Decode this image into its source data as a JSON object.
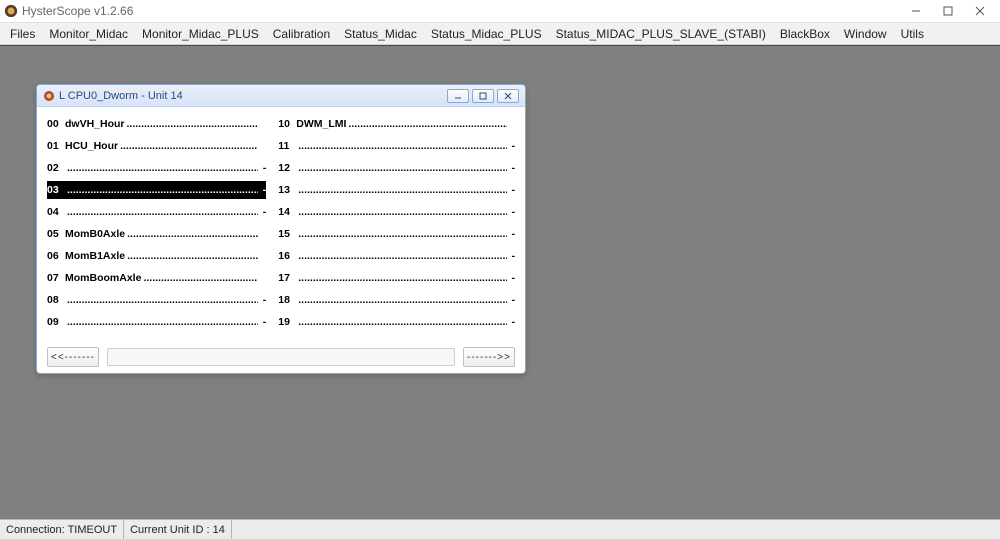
{
  "app": {
    "title": "HysterScope v1.2.66",
    "icon_name": "app-icon",
    "accent": "#3573b8"
  },
  "window_controls": {
    "minimize": "–",
    "maximize": "☐",
    "close": "✕"
  },
  "menubar": [
    "Files",
    "Monitor_Midac",
    "Monitor_Midac_PLUS",
    "Calibration",
    "Status_Midac",
    "Status_Midac_PLUS",
    "Status_MIDAC_PLUS_SLAVE_(STABI)",
    "BlackBox",
    "Window",
    "Utils"
  ],
  "child_window": {
    "title": "L CPU0_Dworm - Unit 14",
    "buttons": {
      "min": "–",
      "max": "☐",
      "close": "✕"
    },
    "nav": {
      "prev": "<<-------",
      "next": "------->>"
    },
    "selected_index_left": 3,
    "left": [
      {
        "num": "00",
        "label": "dwVH_Hour",
        "val": ""
      },
      {
        "num": "01",
        "label": "HCU_Hour",
        "val": ""
      },
      {
        "num": "02",
        "label": "",
        "val": "-"
      },
      {
        "num": "03",
        "label": "",
        "val": "-"
      },
      {
        "num": "04",
        "label": "",
        "val": "-"
      },
      {
        "num": "05",
        "label": "MomB0Axle",
        "val": ""
      },
      {
        "num": "06",
        "label": "MomB1Axle",
        "val": ""
      },
      {
        "num": "07",
        "label": "MomBoomAxle",
        "val": ""
      },
      {
        "num": "08",
        "label": "",
        "val": "-"
      },
      {
        "num": "09",
        "label": "",
        "val": "-"
      }
    ],
    "right": [
      {
        "num": "10",
        "label": "DWM_LMI",
        "val": ""
      },
      {
        "num": "11",
        "label": "",
        "val": "-"
      },
      {
        "num": "12",
        "label": "",
        "val": "-"
      },
      {
        "num": "13",
        "label": "",
        "val": "-"
      },
      {
        "num": "14",
        "label": "",
        "val": "-"
      },
      {
        "num": "15",
        "label": "",
        "val": "-"
      },
      {
        "num": "16",
        "label": "",
        "val": "-"
      },
      {
        "num": "17",
        "label": "",
        "val": "-"
      },
      {
        "num": "18",
        "label": "",
        "val": "-"
      },
      {
        "num": "19",
        "label": "",
        "val": "-"
      }
    ]
  },
  "statusbar": {
    "connection": "Connection: TIMEOUT",
    "unit": "Current Unit ID : 14"
  }
}
